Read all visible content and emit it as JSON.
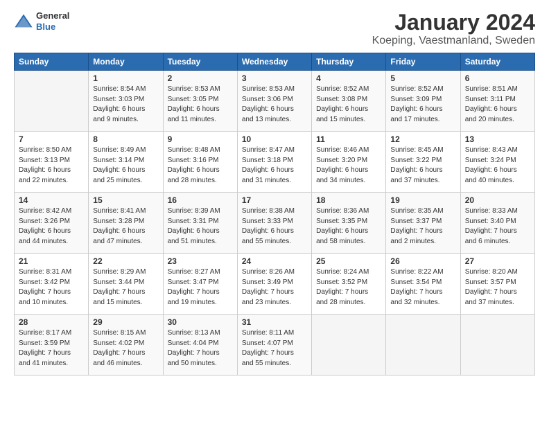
{
  "logo": {
    "general": "General",
    "blue": "Blue"
  },
  "header": {
    "title": "January 2024",
    "subtitle": "Koeping, Vaestmanland, Sweden"
  },
  "days_of_week": [
    "Sunday",
    "Monday",
    "Tuesday",
    "Wednesday",
    "Thursday",
    "Friday",
    "Saturday"
  ],
  "weeks": [
    [
      {
        "day": "",
        "info": ""
      },
      {
        "day": "1",
        "info": "Sunrise: 8:54 AM\nSunset: 3:03 PM\nDaylight: 6 hours\nand 9 minutes."
      },
      {
        "day": "2",
        "info": "Sunrise: 8:53 AM\nSunset: 3:05 PM\nDaylight: 6 hours\nand 11 minutes."
      },
      {
        "day": "3",
        "info": "Sunrise: 8:53 AM\nSunset: 3:06 PM\nDaylight: 6 hours\nand 13 minutes."
      },
      {
        "day": "4",
        "info": "Sunrise: 8:52 AM\nSunset: 3:08 PM\nDaylight: 6 hours\nand 15 minutes."
      },
      {
        "day": "5",
        "info": "Sunrise: 8:52 AM\nSunset: 3:09 PM\nDaylight: 6 hours\nand 17 minutes."
      },
      {
        "day": "6",
        "info": "Sunrise: 8:51 AM\nSunset: 3:11 PM\nDaylight: 6 hours\nand 20 minutes."
      }
    ],
    [
      {
        "day": "7",
        "info": "Sunrise: 8:50 AM\nSunset: 3:13 PM\nDaylight: 6 hours\nand 22 minutes."
      },
      {
        "day": "8",
        "info": "Sunrise: 8:49 AM\nSunset: 3:14 PM\nDaylight: 6 hours\nand 25 minutes."
      },
      {
        "day": "9",
        "info": "Sunrise: 8:48 AM\nSunset: 3:16 PM\nDaylight: 6 hours\nand 28 minutes."
      },
      {
        "day": "10",
        "info": "Sunrise: 8:47 AM\nSunset: 3:18 PM\nDaylight: 6 hours\nand 31 minutes."
      },
      {
        "day": "11",
        "info": "Sunrise: 8:46 AM\nSunset: 3:20 PM\nDaylight: 6 hours\nand 34 minutes."
      },
      {
        "day": "12",
        "info": "Sunrise: 8:45 AM\nSunset: 3:22 PM\nDaylight: 6 hours\nand 37 minutes."
      },
      {
        "day": "13",
        "info": "Sunrise: 8:43 AM\nSunset: 3:24 PM\nDaylight: 6 hours\nand 40 minutes."
      }
    ],
    [
      {
        "day": "14",
        "info": "Sunrise: 8:42 AM\nSunset: 3:26 PM\nDaylight: 6 hours\nand 44 minutes."
      },
      {
        "day": "15",
        "info": "Sunrise: 8:41 AM\nSunset: 3:28 PM\nDaylight: 6 hours\nand 47 minutes."
      },
      {
        "day": "16",
        "info": "Sunrise: 8:39 AM\nSunset: 3:31 PM\nDaylight: 6 hours\nand 51 minutes."
      },
      {
        "day": "17",
        "info": "Sunrise: 8:38 AM\nSunset: 3:33 PM\nDaylight: 6 hours\nand 55 minutes."
      },
      {
        "day": "18",
        "info": "Sunrise: 8:36 AM\nSunset: 3:35 PM\nDaylight: 6 hours\nand 58 minutes."
      },
      {
        "day": "19",
        "info": "Sunrise: 8:35 AM\nSunset: 3:37 PM\nDaylight: 7 hours\nand 2 minutes."
      },
      {
        "day": "20",
        "info": "Sunrise: 8:33 AM\nSunset: 3:40 PM\nDaylight: 7 hours\nand 6 minutes."
      }
    ],
    [
      {
        "day": "21",
        "info": "Sunrise: 8:31 AM\nSunset: 3:42 PM\nDaylight: 7 hours\nand 10 minutes."
      },
      {
        "day": "22",
        "info": "Sunrise: 8:29 AM\nSunset: 3:44 PM\nDaylight: 7 hours\nand 15 minutes."
      },
      {
        "day": "23",
        "info": "Sunrise: 8:27 AM\nSunset: 3:47 PM\nDaylight: 7 hours\nand 19 minutes."
      },
      {
        "day": "24",
        "info": "Sunrise: 8:26 AM\nSunset: 3:49 PM\nDaylight: 7 hours\nand 23 minutes."
      },
      {
        "day": "25",
        "info": "Sunrise: 8:24 AM\nSunset: 3:52 PM\nDaylight: 7 hours\nand 28 minutes."
      },
      {
        "day": "26",
        "info": "Sunrise: 8:22 AM\nSunset: 3:54 PM\nDaylight: 7 hours\nand 32 minutes."
      },
      {
        "day": "27",
        "info": "Sunrise: 8:20 AM\nSunset: 3:57 PM\nDaylight: 7 hours\nand 37 minutes."
      }
    ],
    [
      {
        "day": "28",
        "info": "Sunrise: 8:17 AM\nSunset: 3:59 PM\nDaylight: 7 hours\nand 41 minutes."
      },
      {
        "day": "29",
        "info": "Sunrise: 8:15 AM\nSunset: 4:02 PM\nDaylight: 7 hours\nand 46 minutes."
      },
      {
        "day": "30",
        "info": "Sunrise: 8:13 AM\nSunset: 4:04 PM\nDaylight: 7 hours\nand 50 minutes."
      },
      {
        "day": "31",
        "info": "Sunrise: 8:11 AM\nSunset: 4:07 PM\nDaylight: 7 hours\nand 55 minutes."
      },
      {
        "day": "",
        "info": ""
      },
      {
        "day": "",
        "info": ""
      },
      {
        "day": "",
        "info": ""
      }
    ]
  ]
}
